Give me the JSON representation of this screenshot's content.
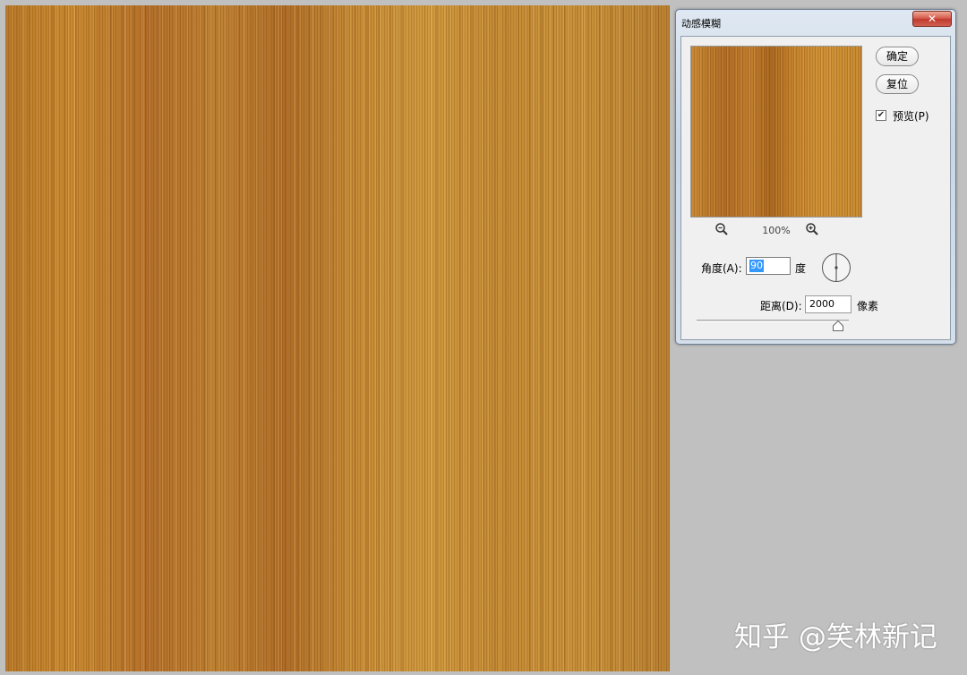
{
  "dialog": {
    "title": "动感模糊",
    "close_glyph": "✕",
    "ok_label": "确定",
    "reset_label": "复位",
    "preview_label": "预览(P)",
    "preview_checked": true,
    "zoom_level": "100%",
    "angle_label": "角度(A):",
    "angle_value": "90",
    "angle_unit": "度",
    "distance_label": "距离(D):",
    "distance_value": "2000",
    "distance_unit": "像素",
    "distance_slider_position": 0.93
  },
  "icons": {
    "zoom_out": "zoom-out-icon",
    "zoom_in": "zoom-in-icon",
    "angle_dial": "angle-dial-icon",
    "slider_thumb": "slider-thumb"
  },
  "colors": {
    "wood_base": "#c0852c",
    "selection": "#3399ff",
    "close_button": "#c94a3c"
  },
  "watermark": {
    "text": "知乎 @笑林新记"
  }
}
